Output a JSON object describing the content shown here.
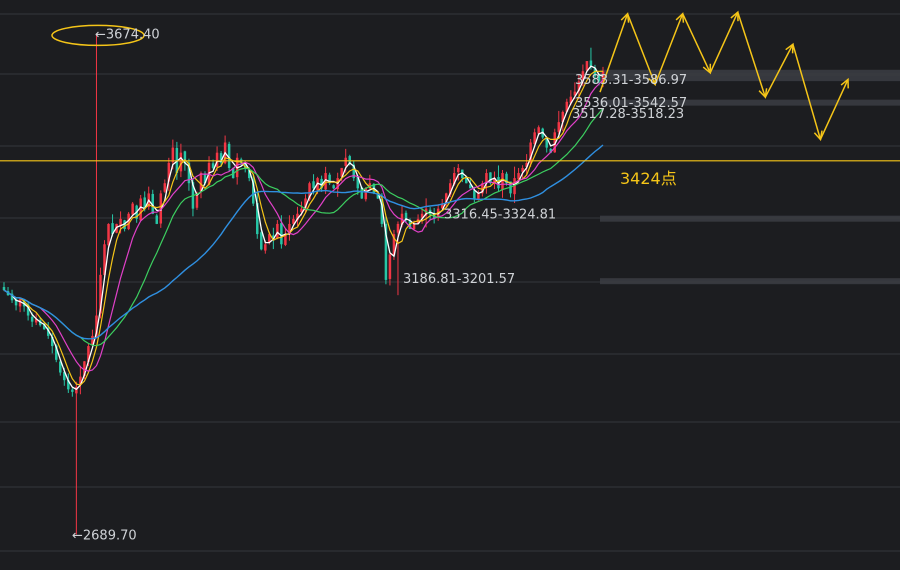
{
  "chart_data": {
    "type": "candlestick",
    "title": "",
    "xlabel": "",
    "ylabel": "",
    "ylim": [
      2620,
      3740
    ],
    "grid": true,
    "key_level": {
      "value": 3424,
      "label": "3424点",
      "color": "#f5c518"
    },
    "price_annotations": [
      {
        "text": "←3674.40",
        "value": 3674.4
      },
      {
        "text": "←2689.70",
        "value": 2689.7
      },
      {
        "text": "3583.31-3586.97",
        "value": 3585.14
      },
      {
        "text": "3536.01-3542.57",
        "value": 3539.29
      },
      {
        "text": "3517.28-3518.23",
        "value": 3517.76
      },
      {
        "text": "3316.45-3324.81",
        "value": 3320.63
      },
      {
        "text": "3186.81-3201.57",
        "value": 3194.19
      }
    ],
    "resistance_bands": [
      3597.0,
      3586.5,
      3538.3,
      3310.3,
      3187.5
    ],
    "forecast_path": [
      3559,
      3713,
      3574,
      3713,
      3597,
      3716,
      3549,
      3653,
      3466,
      3584
    ],
    "close": [
      3170,
      3160,
      3150,
      3140,
      3152,
      3138,
      3120,
      3108,
      3113,
      3101,
      3093,
      3080,
      3060,
      3033,
      3008,
      2993,
      2975,
      2970,
      2980,
      3000,
      3030,
      3060,
      3080,
      3120,
      3200,
      3260,
      3300,
      3280,
      3300,
      3310,
      3290,
      3320,
      3340,
      3310,
      3350,
      3330,
      3360,
      3320,
      3300,
      3360,
      3380,
      3420,
      3450,
      3400,
      3440,
      3420,
      3380,
      3330,
      3360,
      3400,
      3380,
      3420,
      3410,
      3440,
      3420,
      3460,
      3410,
      3390,
      3430,
      3420,
      3410,
      3390,
      3340,
      3280,
      3250,
      3260,
      3280,
      3270,
      3300,
      3260,
      3280,
      3300,
      3310,
      3320,
      3330,
      3350,
      3380,
      3370,
      3390,
      3370,
      3400,
      3380,
      3370,
      3390,
      3410,
      3430,
      3420,
      3390,
      3370,
      3350,
      3370,
      3380,
      3360,
      3350,
      3300,
      3190,
      3240,
      3280,
      3300,
      3320,
      3310,
      3290,
      3300,
      3310,
      3320,
      3330,
      3320,
      3310,
      3330,
      3340,
      3360,
      3380,
      3400,
      3410,
      3390,
      3380,
      3370,
      3350,
      3360,
      3380,
      3400,
      3380,
      3390,
      3370,
      3400,
      3380,
      3360,
      3390,
      3400,
      3410,
      3420,
      3460,
      3480,
      3490,
      3470,
      3450,
      3440,
      3480,
      3500,
      3520,
      3540,
      3550,
      3560,
      3580,
      3600,
      3620,
      3610,
      3590,
      3580,
      3600
    ]
  }
}
